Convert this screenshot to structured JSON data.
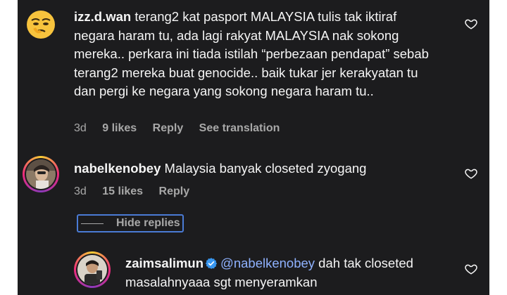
{
  "comments": [
    {
      "username": "izz.d.wan",
      "text": "terang2 kat pasport MALAYSIA tulis tak iktiraf negara haram tu, ada lagi rakyat MALAYSIA nak sokong mereka.. perkara ini tiada istilah “perbezaan pendapat” sebab terang2 mereka buat genocide.. baik tukar jer kerakyatan tu dan pergi ke negara yang sokong negara haram tu..",
      "time": "3d",
      "likes": "9 likes",
      "reply": "Reply",
      "see_translation": "See translation"
    },
    {
      "username": "nabelkenobey",
      "text": "Malaysia banyak closeted zyogang",
      "time": "3d",
      "likes": "15 likes",
      "reply": "Reply"
    }
  ],
  "hide_replies_label": "Hide replies",
  "reply_comment": {
    "username": "zaimsalimun",
    "mention": "@nabelkenobey",
    "text": " dah tak closeted masalahnyaaa sgt menyeramkan"
  },
  "colors": {
    "background": "#1c1c1e",
    "text": "#f5f5f5",
    "meta": "#a8a8a8",
    "mention": "#8fb2ff",
    "verified": "#3897f0",
    "focus_outline": "#4a7bd5"
  },
  "icons": [
    "heart-icon",
    "verified-badge-icon",
    "avatar"
  ]
}
